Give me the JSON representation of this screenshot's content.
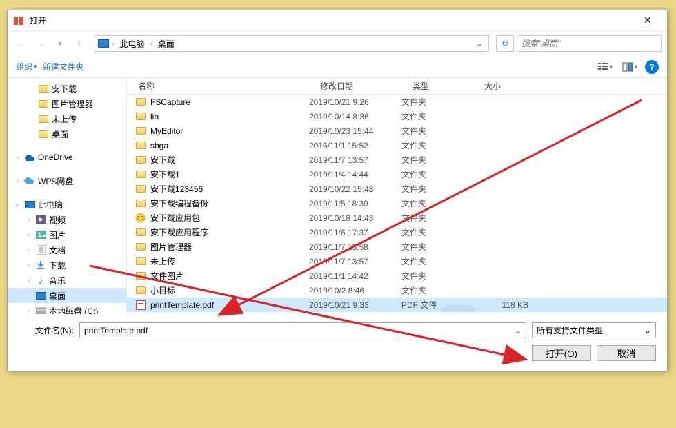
{
  "dialog": {
    "title": "打开"
  },
  "breadcrumb": {
    "root": "此电脑",
    "current": "桌面"
  },
  "search": {
    "placeholder": "搜索\"桌面\""
  },
  "toolbar": {
    "organize": "组织",
    "new_folder": "新建文件夹"
  },
  "columns": {
    "name": "名称",
    "date": "修改日期",
    "type": "类型",
    "size": "大小"
  },
  "sidebar_quick": [
    {
      "label": "安下载",
      "indent": 44
    },
    {
      "label": "图片管理器",
      "indent": 44
    },
    {
      "label": "未上传",
      "indent": 44
    },
    {
      "label": "桌面",
      "indent": 44
    }
  ],
  "sidebar_drives": [
    {
      "label": "OneDrive",
      "icon": "onedrive",
      "arrow": "›",
      "indent": 8
    },
    {
      "label": "WPS网盘",
      "icon": "wps",
      "arrow": "›",
      "indent": 8
    }
  ],
  "sidebar_pc": {
    "label": "此电脑",
    "arrow": "⌄",
    "indent": 8
  },
  "sidebar_pc_children": [
    {
      "label": "视频",
      "icon": "video",
      "arrow": "›"
    },
    {
      "label": "图片",
      "icon": "picture",
      "arrow": "›"
    },
    {
      "label": "文档",
      "icon": "document",
      "arrow": "›"
    },
    {
      "label": "下载",
      "icon": "download",
      "arrow": "›"
    },
    {
      "label": "音乐",
      "icon": "music",
      "arrow": "›"
    },
    {
      "label": "桌面",
      "icon": "desktop",
      "arrow": "",
      "selected": true
    },
    {
      "label": "本地磁盘 (C:)",
      "icon": "disk",
      "arrow": "›"
    }
  ],
  "files": [
    {
      "name": "FSCapture",
      "date": "2019/10/21 9:26",
      "type": "文件夹",
      "size": "",
      "icon": "folder"
    },
    {
      "name": "lib",
      "date": "2019/10/14 8:36",
      "type": "文件夹",
      "size": "",
      "icon": "folder"
    },
    {
      "name": "MyEditor",
      "date": "2019/10/23 15:44",
      "type": "文件夹",
      "size": "",
      "icon": "folder"
    },
    {
      "name": "sbga",
      "date": "2016/11/1 15:52",
      "type": "文件夹",
      "size": "",
      "icon": "folder"
    },
    {
      "name": "安下载",
      "date": "2019/11/7 13:57",
      "type": "文件夹",
      "size": "",
      "icon": "folder"
    },
    {
      "name": "安下载1",
      "date": "2019/11/4 14:44",
      "type": "文件夹",
      "size": "",
      "icon": "folder"
    },
    {
      "name": "安下载123456",
      "date": "2019/10/22 15:48",
      "type": "文件夹",
      "size": "",
      "icon": "folder"
    },
    {
      "name": "安下载编程备份",
      "date": "2019/11/5 18:39",
      "type": "文件夹",
      "size": "",
      "icon": "folder"
    },
    {
      "name": "安下载应用包",
      "date": "2019/10/18 14:43",
      "type": "文件夹",
      "size": "",
      "icon": "emoji"
    },
    {
      "name": "安下载应用程序",
      "date": "2019/11/6 17:37",
      "type": "文件夹",
      "size": "",
      "icon": "folder"
    },
    {
      "name": "图片管理器",
      "date": "2019/11/7 13:58",
      "type": "文件夹",
      "size": "",
      "icon": "folder"
    },
    {
      "name": "未上传",
      "date": "2019/11/7 13:57",
      "type": "文件夹",
      "size": "",
      "icon": "folder"
    },
    {
      "name": "文件图片",
      "date": "2019/11/1 14:42",
      "type": "文件夹",
      "size": "",
      "icon": "folder"
    },
    {
      "name": "小目标",
      "date": "2019/10/2 8:46",
      "type": "文件夹",
      "size": "",
      "icon": "folder"
    },
    {
      "name": "printTemplate.pdf",
      "date": "2019/10/21 9:33",
      "type": "PDF 文件",
      "size": "118 KB",
      "icon": "pdf",
      "selected": true
    }
  ],
  "filename": {
    "label": "文件名(N):",
    "value": "printTemplate.pdf"
  },
  "filter": {
    "label": "所有支持文件类型"
  },
  "buttons": {
    "open": "打开(O)",
    "cancel": "取消"
  }
}
